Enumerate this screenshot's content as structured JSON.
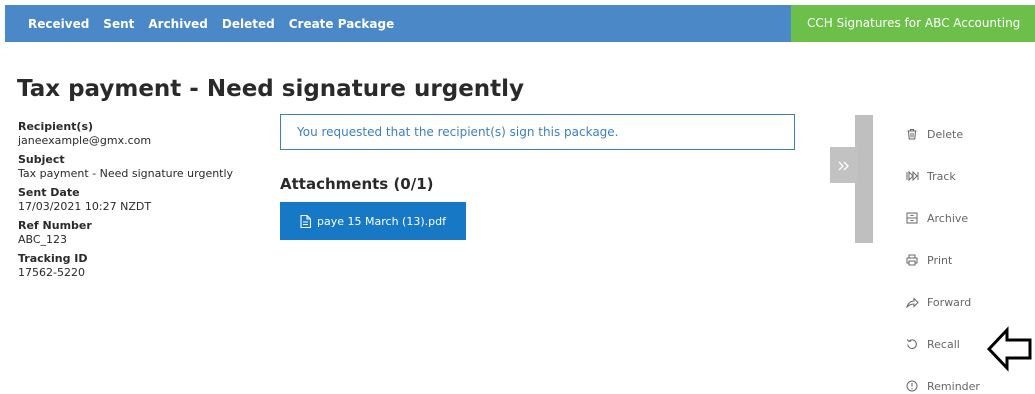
{
  "nav": {
    "items": [
      {
        "label": "Received"
      },
      {
        "label": "Sent"
      },
      {
        "label": "Archived"
      },
      {
        "label": "Deleted"
      },
      {
        "label": "Create Package"
      }
    ],
    "brand": "CCH Signatures for ABC Accounting"
  },
  "page": {
    "title": "Tax payment - Need signature urgently"
  },
  "details": {
    "recipients_label": "Recipient(s)",
    "recipients_value": "janeexample@gmx.com",
    "subject_label": "Subject",
    "subject_value": "Tax payment - Need signature urgently",
    "sent_date_label": "Sent Date",
    "sent_date_value": "17/03/2021 10:27 NZDT",
    "ref_label": "Ref Number",
    "ref_value": "ABC_123",
    "tracking_label": "Tracking ID",
    "tracking_value": "17562-5220"
  },
  "notice": "You requested that the recipient(s) sign this package.",
  "attachments": {
    "heading": "Attachments (0/1)",
    "files": [
      {
        "name": "paye 15 March (13).pdf",
        "icon": "file-icon"
      }
    ]
  },
  "actions": [
    {
      "label": "Delete",
      "icon": "trash-icon"
    },
    {
      "label": "Track",
      "icon": "track-icon"
    },
    {
      "label": "Archive",
      "icon": "archive-icon"
    },
    {
      "label": "Print",
      "icon": "printer-icon"
    },
    {
      "label": "Forward",
      "icon": "forward-icon"
    },
    {
      "label": "Recall",
      "icon": "recall-icon"
    },
    {
      "label": "Reminder",
      "icon": "reminder-icon"
    }
  ],
  "colors": {
    "nav_bg": "#4a88c7",
    "brand_bg": "#6cc04a",
    "primary": "#1778c6",
    "notice_border": "#3d7fbf",
    "action_text": "#666666",
    "panel_bar": "#bfbfbf"
  }
}
